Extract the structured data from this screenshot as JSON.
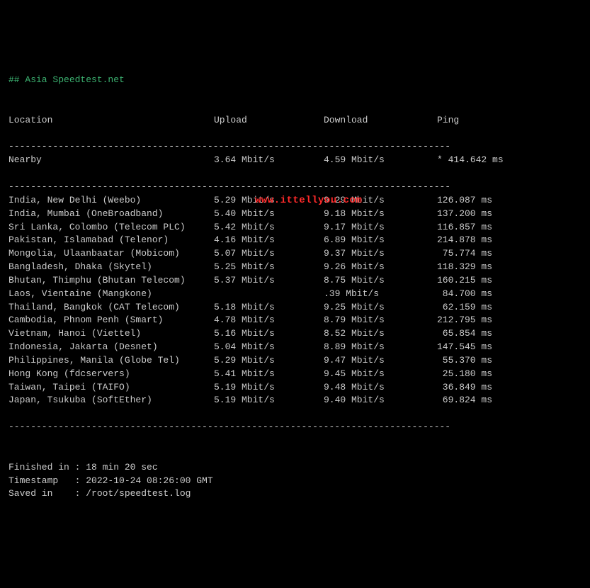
{
  "title": "## Asia Speedtest.net",
  "headers": {
    "location": "Location",
    "upload": "Upload",
    "download": "Download",
    "ping": "Ping"
  },
  "divider": "--------------------------------------------------------------------------------",
  "nearby": {
    "location": "Nearby",
    "upload": "3.64 Mbit/s",
    "download": "4.59 Mbit/s",
    "ping": "* 414.642 ms"
  },
  "rows": [
    {
      "location": "India, New Delhi (Weebo)",
      "upload": "5.29 Mbit/s",
      "download": "9.29 Mbit/s",
      "ping": "126.087 ms"
    },
    {
      "location": "India, Mumbai (OneBroadband)",
      "upload": "5.40 Mbit/s",
      "download": "9.18 Mbit/s",
      "ping": "137.200 ms"
    },
    {
      "location": "Sri Lanka, Colombo (Telecom PLC)",
      "upload": "5.42 Mbit/s",
      "download": "9.17 Mbit/s",
      "ping": "116.857 ms"
    },
    {
      "location": "Pakistan, Islamabad (Telenor)",
      "upload": "4.16 Mbit/s",
      "download": "6.89 Mbit/s",
      "ping": "214.878 ms"
    },
    {
      "location": "Mongolia, Ulaanbaatar (Mobicom)",
      "upload": "5.07 Mbit/s",
      "download": "9.37 Mbit/s",
      "ping": " 75.774 ms"
    },
    {
      "location": "Bangladesh, Dhaka (Skytel)",
      "upload": "5.25 Mbit/s",
      "download": "9.26 Mbit/s",
      "ping": "118.329 ms"
    },
    {
      "location": "Bhutan, Thimphu (Bhutan Telecom)",
      "upload": "5.37 Mbit/s",
      "download": "8.75 Mbit/s",
      "ping": "160.215 ms"
    },
    {
      "location": "Laos, Vientaine (Mangkone)",
      "upload": "",
      "download": ".39 Mbit/s",
      "ping": " 84.700 ms"
    },
    {
      "location": "Thailand, Bangkok (CAT Telecom)",
      "upload": "5.18 Mbit/s",
      "download": "9.25 Mbit/s",
      "ping": " 62.159 ms"
    },
    {
      "location": "Cambodia, Phnom Penh (Smart)",
      "upload": "4.78 Mbit/s",
      "download": "8.79 Mbit/s",
      "ping": "212.795 ms"
    },
    {
      "location": "Vietnam, Hanoi (Viettel)",
      "upload": "5.16 Mbit/s",
      "download": "8.52 Mbit/s",
      "ping": " 65.854 ms"
    },
    {
      "location": "Indonesia, Jakarta (Desnet)",
      "upload": "5.04 Mbit/s",
      "download": "8.89 Mbit/s",
      "ping": "147.545 ms"
    },
    {
      "location": "Philippines, Manila (Globe Tel)",
      "upload": "5.29 Mbit/s",
      "download": "9.47 Mbit/s",
      "ping": " 55.370 ms"
    },
    {
      "location": "Hong Kong (fdcservers)",
      "upload": "5.41 Mbit/s",
      "download": "9.45 Mbit/s",
      "ping": " 25.180 ms"
    },
    {
      "location": "Taiwan, Taipei (TAIFO)",
      "upload": "5.19 Mbit/s",
      "download": "9.48 Mbit/s",
      "ping": " 36.849 ms"
    },
    {
      "location": "Japan, Tsukuba (SoftEther)",
      "upload": "5.19 Mbit/s",
      "download": "9.40 Mbit/s",
      "ping": " 69.824 ms"
    }
  ],
  "footer": {
    "finished": "Finished in : 18 min 20 sec",
    "timestamp": "Timestamp   : 2022-10-24 08:26:00 GMT",
    "saved": "Saved in    : /root/speedtest.log"
  },
  "watermark": "www.ittellyou.com"
}
